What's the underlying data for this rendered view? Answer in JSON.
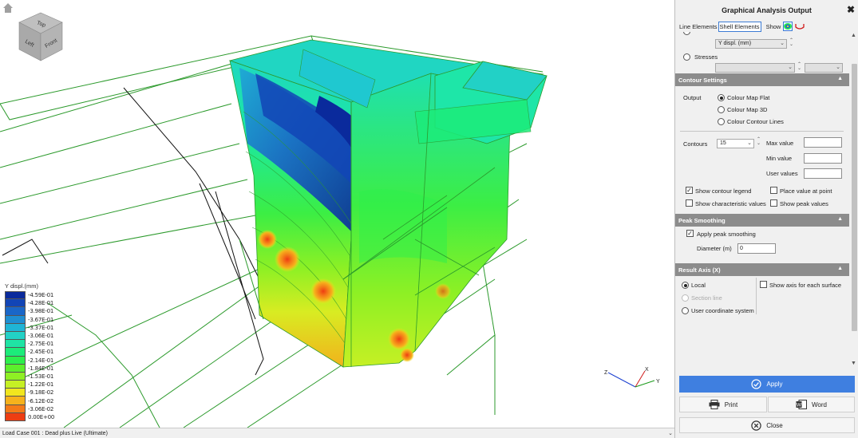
{
  "panel": {
    "title": "Graphical Analysis Output",
    "tabs": [
      "Line Elements",
      "Shell Elements"
    ],
    "show_label": "Show",
    "displacement_combo": "Y displ. (mm)",
    "stresses_label": "Stresses",
    "contour_settings": {
      "heading": "Contour Settings",
      "output_label": "Output",
      "options": [
        "Colour Map Flat",
        "Colour Map 3D",
        "Colour Contour Lines"
      ],
      "selected": "Colour Map Flat",
      "contours_label": "Contours",
      "contours_value": "15",
      "max_value_label": "Max value",
      "min_value_label": "Min value",
      "user_values_label": "User values",
      "show_contour_legend": "Show contour legend",
      "place_value_at_point": "Place value at point",
      "show_characteristic_values": "Show characteristic values",
      "show_peak_values": "Show peak values"
    },
    "peak_smoothing": {
      "heading": "Peak Smoothing",
      "apply_label": "Apply peak smoothing",
      "diameter_label": "Diameter (m)",
      "diameter_value": "0"
    },
    "result_axis": {
      "heading": "Result Axis (X)",
      "options": [
        "Local",
        "Section line",
        "User coordinate system"
      ],
      "selected": "Local",
      "show_axis_label": "Show axis for each surface"
    },
    "buttons": {
      "apply": "Apply",
      "print": "Print",
      "word": "Word",
      "close": "Close"
    }
  },
  "legend": {
    "title": "Y displ.(mm)",
    "entries": [
      {
        "label": "-4.59E-01",
        "color": "#0a2a9c"
      },
      {
        "label": "-4.28E-01",
        "color": "#1245b6"
      },
      {
        "label": "-3.98E-01",
        "color": "#1a66c8"
      },
      {
        "label": "-3.67E-01",
        "color": "#1f8ed2"
      },
      {
        "label": "-3.37E-01",
        "color": "#1fb5d6"
      },
      {
        "label": "-3.06E-01",
        "color": "#22d1c6"
      },
      {
        "label": "-2.75E-01",
        "color": "#1fe4a4"
      },
      {
        "label": "-2.45E-01",
        "color": "#1cec7a"
      },
      {
        "label": "-2.14E-01",
        "color": "#2cef4c"
      },
      {
        "label": "-1.84E-01",
        "color": "#5def2c"
      },
      {
        "label": "-1.53E-01",
        "color": "#8ef024"
      },
      {
        "label": "-1.22E-01",
        "color": "#c6f024"
      },
      {
        "label": "-9.18E-02",
        "color": "#f1e61e"
      },
      {
        "label": "-6.12E-02",
        "color": "#f6b21c"
      },
      {
        "label": "-3.06E-02",
        "color": "#f47a18"
      },
      {
        "label": "0.00E+00",
        "color": "#ee3d12"
      }
    ]
  },
  "status": {
    "load_case": "Load Case 001 : Dead plus Live (Ultimate)"
  },
  "nav_cube": {
    "top": "Top",
    "left": "Left",
    "front": "Front"
  },
  "axes": {
    "x": "X",
    "y": "Y",
    "z": "Z"
  },
  "icons": [
    "home-icon",
    "view-cube-icon",
    "close-icon",
    "contour-map-icon",
    "deflected-shape-icon",
    "checkmark-icon",
    "printer-icon",
    "word-icon",
    "close-circle-icon"
  ],
  "colors": {
    "accent": "#3f7fe0",
    "section_header": "#8c8c8c",
    "mesh_line": "#2c9a2c"
  }
}
